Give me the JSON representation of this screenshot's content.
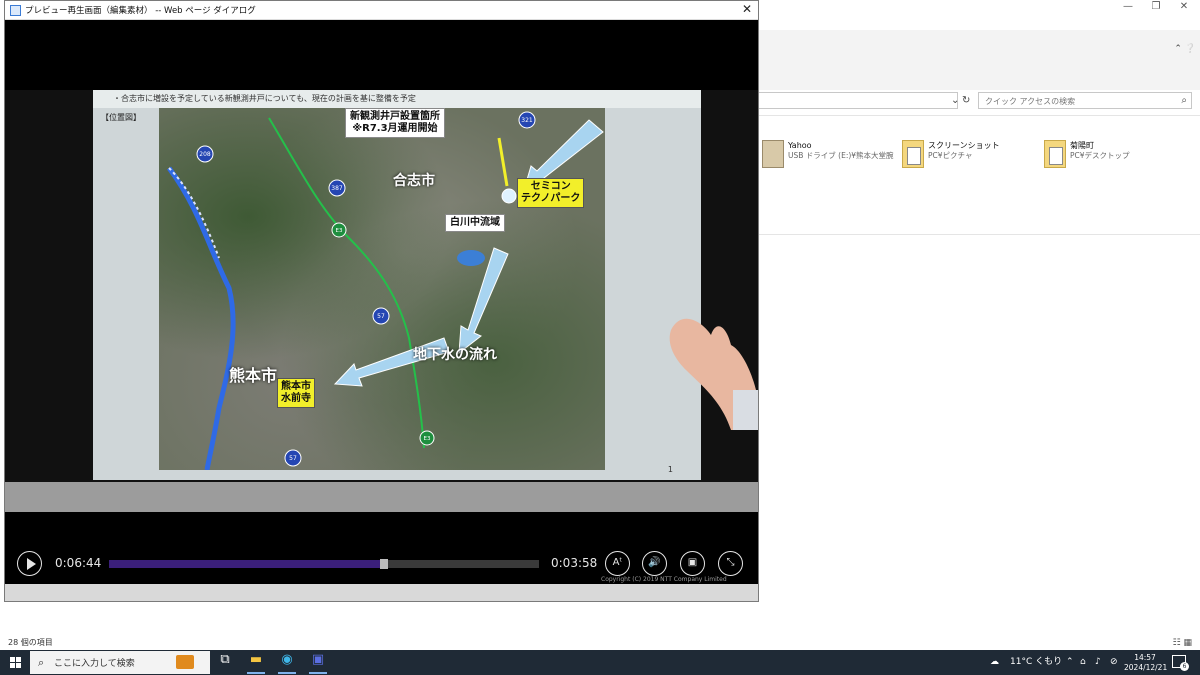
{
  "explorer": {
    "search_placeholder": "クイック アクセスの検索",
    "items": [
      {
        "name": "Yahoo",
        "sub": "USB ドライブ (E:)¥熊本大堂腕"
      },
      {
        "name": "スクリーンショット",
        "sub": "PC¥ピクチャ"
      },
      {
        "name": "菊陽町",
        "sub": "PC¥デスクトップ"
      }
    ],
    "status": "28 個の項目"
  },
  "dialog": {
    "title": "プレビュー再生画面（編集素材） -- Web ページ ダイアログ",
    "close": "✕"
  },
  "slide": {
    "header": "・合志市に増設を予定している新観測井戸についても、現在の計画を基に整備を予定",
    "tag": "【位置図】",
    "page": "1",
    "labels": {
      "koshi": "合志市",
      "kumamoto": "熊本市",
      "groundwater": "地下水の流れ",
      "new_well_line1": "新観測井戸設置箇所",
      "new_well_line2": "※R7.3月運用開始",
      "shirakawa": "白川中流域",
      "semicon_line1": "セミコン",
      "semicon_line2": "テクノパーク",
      "suizenji_line1": "熊本市",
      "suizenji_line2": "水前寺"
    },
    "road_numbers": [
      "208",
      "387",
      "321",
      "57",
      "57"
    ],
    "highway_labels": [
      "E3",
      "E3"
    ]
  },
  "player": {
    "elapsed": "0:06:44",
    "remaining": "0:03:58",
    "progress_fraction": 0.63,
    "caption_icon": "Aᵗ",
    "volume_icon": "🔊",
    "copyright": "Copyright (C) 2019 NTT Company Limited"
  },
  "taskbar": {
    "search_placeholder": "ここに入力して検索",
    "weather": "11°C くもり",
    "time": "14:57",
    "date": "2024/12/21",
    "notification_count": "6"
  },
  "colors": {
    "accent_progress": "#3b1f7a",
    "callout_yellow": "#f2ef2a",
    "arrow_blue": "#a8d4f0",
    "taskbar": "#1f2a36"
  }
}
